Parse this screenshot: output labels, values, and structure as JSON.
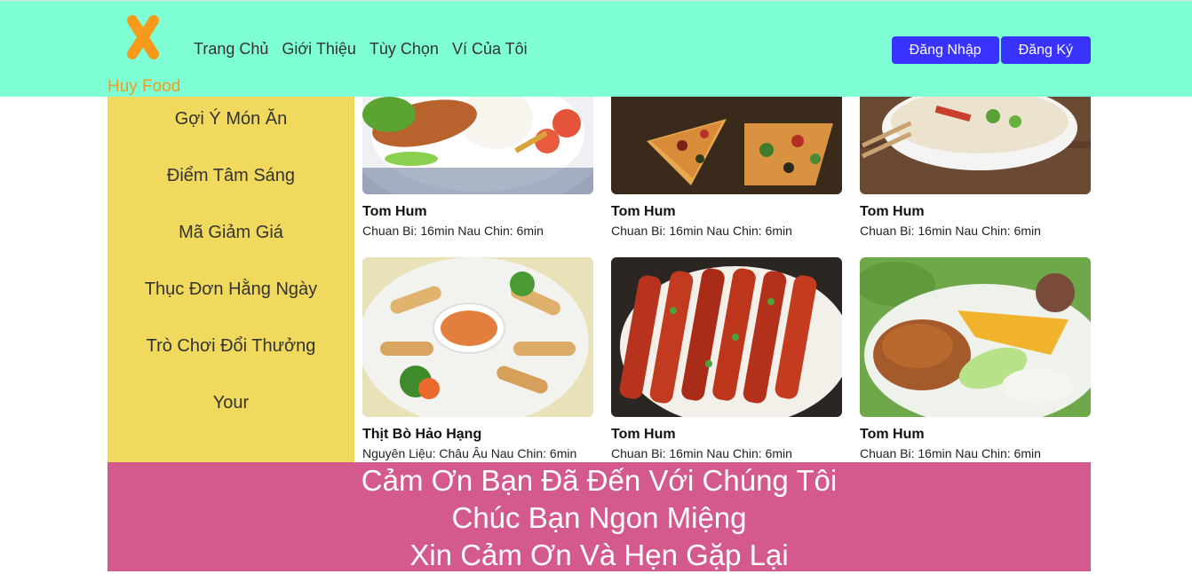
{
  "header": {
    "brand": "Huy Food",
    "nav": [
      "Trang Chủ",
      "Giới Thiệu",
      "Tùy Chọn",
      "Ví Của Tôi"
    ],
    "login_label": "Đăng Nhập",
    "register_label": "Đăng Ký"
  },
  "sidebar": {
    "items": [
      "Gợi Ý Món Ăn",
      "Điểm Tâm Sáng",
      "Mã Giảm Giá",
      "Thục Đơn Hằng Ngày",
      "Trò Chơi Đổi Thưởng",
      "Your"
    ]
  },
  "cards": [
    {
      "name": "Tom Hum",
      "meta": "Chuan Bi: 16min Nau Chin: 6min",
      "image": "grilled-fish-rice-photo"
    },
    {
      "name": "Tom Hum",
      "meta": "Chuan Bi: 16min Nau Chin: 6min",
      "image": "pizza-photo"
    },
    {
      "name": "Tom Hum",
      "meta": "Chuan Bi: 16min Nau Chin: 6min",
      "image": "pho-bowl-photo"
    },
    {
      "name": "Thịt Bò Hảo Hạng",
      "meta": "Nguyên Liệu: Châu Âu Nau Chin: 6min",
      "image": "spring-rolls-photo"
    },
    {
      "name": "Tom Hum",
      "meta": "Chuan Bi: 16min Nau Chin: 6min",
      "image": "grilled-skewers-photo"
    },
    {
      "name": "Tom Hum",
      "meta": "Chuan Bi: 16min Nau Chin: 6min",
      "image": "broken-rice-pork-photo"
    }
  ],
  "footer": {
    "line1": "Cảm Ơn Bạn Đã Đến Với Chúng Tôi",
    "line2": "Chúc Bạn Ngon Miệng",
    "line3": "Xin Cảm Ơn Và Hẹn Gặp Lại"
  }
}
